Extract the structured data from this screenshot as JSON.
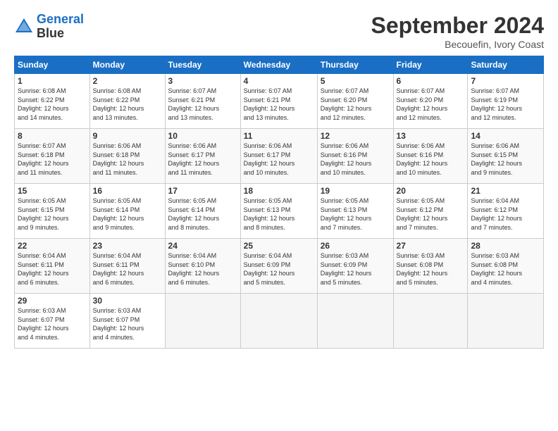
{
  "header": {
    "logo_line1": "General",
    "logo_line2": "Blue",
    "month": "September 2024",
    "location": "Becouefin, Ivory Coast"
  },
  "weekdays": [
    "Sunday",
    "Monday",
    "Tuesday",
    "Wednesday",
    "Thursday",
    "Friday",
    "Saturday"
  ],
  "weeks": [
    [
      {
        "day": "1",
        "info": "Sunrise: 6:08 AM\nSunset: 6:22 PM\nDaylight: 12 hours\nand 14 minutes."
      },
      {
        "day": "2",
        "info": "Sunrise: 6:08 AM\nSunset: 6:22 PM\nDaylight: 12 hours\nand 13 minutes."
      },
      {
        "day": "3",
        "info": "Sunrise: 6:07 AM\nSunset: 6:21 PM\nDaylight: 12 hours\nand 13 minutes."
      },
      {
        "day": "4",
        "info": "Sunrise: 6:07 AM\nSunset: 6:21 PM\nDaylight: 12 hours\nand 13 minutes."
      },
      {
        "day": "5",
        "info": "Sunrise: 6:07 AM\nSunset: 6:20 PM\nDaylight: 12 hours\nand 12 minutes."
      },
      {
        "day": "6",
        "info": "Sunrise: 6:07 AM\nSunset: 6:20 PM\nDaylight: 12 hours\nand 12 minutes."
      },
      {
        "day": "7",
        "info": "Sunrise: 6:07 AM\nSunset: 6:19 PM\nDaylight: 12 hours\nand 12 minutes."
      }
    ],
    [
      {
        "day": "8",
        "info": "Sunrise: 6:07 AM\nSunset: 6:18 PM\nDaylight: 12 hours\nand 11 minutes."
      },
      {
        "day": "9",
        "info": "Sunrise: 6:06 AM\nSunset: 6:18 PM\nDaylight: 12 hours\nand 11 minutes."
      },
      {
        "day": "10",
        "info": "Sunrise: 6:06 AM\nSunset: 6:17 PM\nDaylight: 12 hours\nand 11 minutes."
      },
      {
        "day": "11",
        "info": "Sunrise: 6:06 AM\nSunset: 6:17 PM\nDaylight: 12 hours\nand 10 minutes."
      },
      {
        "day": "12",
        "info": "Sunrise: 6:06 AM\nSunset: 6:16 PM\nDaylight: 12 hours\nand 10 minutes."
      },
      {
        "day": "13",
        "info": "Sunrise: 6:06 AM\nSunset: 6:16 PM\nDaylight: 12 hours\nand 10 minutes."
      },
      {
        "day": "14",
        "info": "Sunrise: 6:06 AM\nSunset: 6:15 PM\nDaylight: 12 hours\nand 9 minutes."
      }
    ],
    [
      {
        "day": "15",
        "info": "Sunrise: 6:05 AM\nSunset: 6:15 PM\nDaylight: 12 hours\nand 9 minutes."
      },
      {
        "day": "16",
        "info": "Sunrise: 6:05 AM\nSunset: 6:14 PM\nDaylight: 12 hours\nand 9 minutes."
      },
      {
        "day": "17",
        "info": "Sunrise: 6:05 AM\nSunset: 6:14 PM\nDaylight: 12 hours\nand 8 minutes."
      },
      {
        "day": "18",
        "info": "Sunrise: 6:05 AM\nSunset: 6:13 PM\nDaylight: 12 hours\nand 8 minutes."
      },
      {
        "day": "19",
        "info": "Sunrise: 6:05 AM\nSunset: 6:13 PM\nDaylight: 12 hours\nand 7 minutes."
      },
      {
        "day": "20",
        "info": "Sunrise: 6:05 AM\nSunset: 6:12 PM\nDaylight: 12 hours\nand 7 minutes."
      },
      {
        "day": "21",
        "info": "Sunrise: 6:04 AM\nSunset: 6:12 PM\nDaylight: 12 hours\nand 7 minutes."
      }
    ],
    [
      {
        "day": "22",
        "info": "Sunrise: 6:04 AM\nSunset: 6:11 PM\nDaylight: 12 hours\nand 6 minutes."
      },
      {
        "day": "23",
        "info": "Sunrise: 6:04 AM\nSunset: 6:11 PM\nDaylight: 12 hours\nand 6 minutes."
      },
      {
        "day": "24",
        "info": "Sunrise: 6:04 AM\nSunset: 6:10 PM\nDaylight: 12 hours\nand 6 minutes."
      },
      {
        "day": "25",
        "info": "Sunrise: 6:04 AM\nSunset: 6:09 PM\nDaylight: 12 hours\nand 5 minutes."
      },
      {
        "day": "26",
        "info": "Sunrise: 6:03 AM\nSunset: 6:09 PM\nDaylight: 12 hours\nand 5 minutes."
      },
      {
        "day": "27",
        "info": "Sunrise: 6:03 AM\nSunset: 6:08 PM\nDaylight: 12 hours\nand 5 minutes."
      },
      {
        "day": "28",
        "info": "Sunrise: 6:03 AM\nSunset: 6:08 PM\nDaylight: 12 hours\nand 4 minutes."
      }
    ],
    [
      {
        "day": "29",
        "info": "Sunrise: 6:03 AM\nSunset: 6:07 PM\nDaylight: 12 hours\nand 4 minutes."
      },
      {
        "day": "30",
        "info": "Sunrise: 6:03 AM\nSunset: 6:07 PM\nDaylight: 12 hours\nand 4 minutes."
      },
      {
        "day": "",
        "info": ""
      },
      {
        "day": "",
        "info": ""
      },
      {
        "day": "",
        "info": ""
      },
      {
        "day": "",
        "info": ""
      },
      {
        "day": "",
        "info": ""
      }
    ]
  ]
}
